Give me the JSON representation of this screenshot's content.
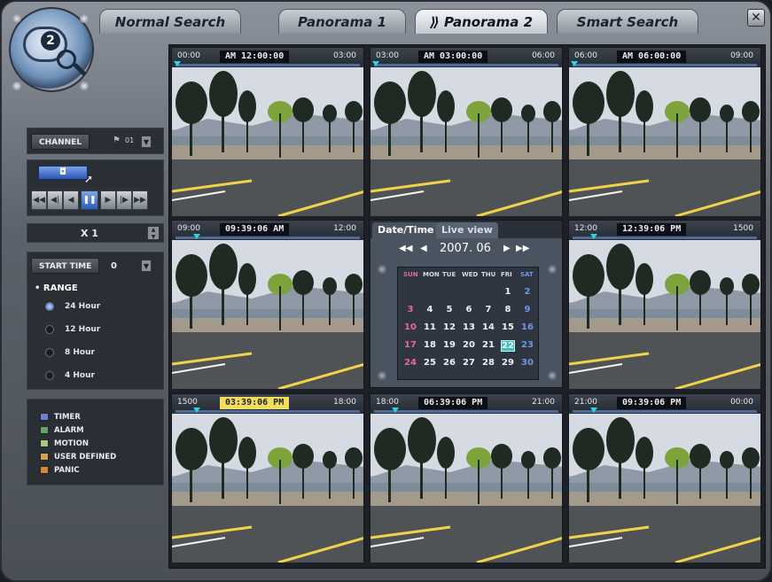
{
  "tabs": [
    {
      "label": "Normal Search",
      "active": false
    },
    {
      "label": "Panorama 1",
      "active": false
    },
    {
      "label": "⟫ Panorama 2",
      "active": true
    },
    {
      "label": "Smart Search",
      "active": false
    }
  ],
  "window": {
    "close_label": "✕"
  },
  "logo": {
    "number": "2"
  },
  "sidebar": {
    "channel_label": "CHANNEL",
    "channel_value": "01",
    "speed": "X 1",
    "start_time_label": "START TIME",
    "start_time_value": "0",
    "range_label": "• RANGE",
    "ranges": [
      "24 Hour",
      "12 Hour",
      "8 Hour",
      "4 Hour"
    ],
    "selected_range": "24 Hour",
    "legend": [
      {
        "label": "TIMER",
        "color": "#6e7fd6"
      },
      {
        "label": "ALARM",
        "color": "#5fa860"
      },
      {
        "label": "MOTION",
        "color": "#a6c97a"
      },
      {
        "label": "USER DEFINED",
        "color": "#d3a24e"
      },
      {
        "label": "PANIC",
        "color": "#d9872f"
      }
    ]
  },
  "panels": [
    {
      "start": "00:00",
      "current": "AM 12:00:00",
      "end": "03:00",
      "highlight": false
    },
    {
      "start": "03:00",
      "current": "AM 03:00:00",
      "end": "06:00",
      "highlight": false
    },
    {
      "start": "06:00",
      "current": "AM 06:00:00",
      "end": "09:00",
      "highlight": false
    },
    {
      "start": "09:00",
      "current": "09:39:06 AM",
      "end": "12:00",
      "highlight": false
    },
    {
      "start": "12:00",
      "current": "12:39:06 PM",
      "end": "1500",
      "highlight": false
    },
    {
      "start": "1500",
      "current": "03:39:06 PM",
      "end": "18:00",
      "highlight": true
    },
    {
      "start": "18:00",
      "current": "06:39:06 PM",
      "end": "21:00",
      "highlight": false
    },
    {
      "start": "21:00",
      "current": "09:39:06 PM",
      "end": "00:00",
      "highlight": false
    }
  ],
  "calendar": {
    "tab_date": "Date/Time",
    "tab_live": "Live view",
    "prev_year": "◀◀",
    "prev_month": "◀",
    "month_label": "2007. 06",
    "next_month": "▶",
    "next_year": "▶▶",
    "weekdays": [
      "SUN",
      "MON",
      "TUE",
      "WED",
      "THU",
      "FRI",
      "SAT"
    ],
    "weeks": [
      [
        "",
        "",
        "",
        "",
        "",
        "1",
        "2"
      ],
      [
        "3",
        "4",
        "5",
        "6",
        "7",
        "8",
        "9"
      ],
      [
        "10",
        "11",
        "12",
        "13",
        "14",
        "15",
        "16"
      ],
      [
        "17",
        "18",
        "19",
        "20",
        "21",
        "22",
        "23"
      ],
      [
        "24",
        "25",
        "26",
        "27",
        "28",
        "29",
        "30"
      ]
    ],
    "selected_day": "22"
  }
}
